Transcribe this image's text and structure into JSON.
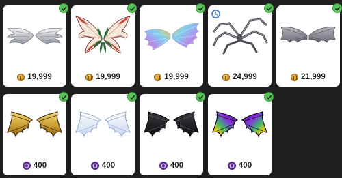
{
  "colors": {
    "background": "#1f1f1f",
    "card": "#ffffff",
    "owned_check": "#5bc15a",
    "coin": "#d39a2a",
    "gem": "#5b2f91",
    "timer": "#3a7bd5"
  },
  "items": [
    {
      "name": "angel-wings-silver",
      "price": "19,999",
      "currency": "coin-icon",
      "owned": true,
      "limited": false
    },
    {
      "name": "fairy-wings-red-green",
      "price": "19,999",
      "currency": "coin-icon",
      "owned": true,
      "limited": false
    },
    {
      "name": "rainbow-feather-wings",
      "price": "19,999",
      "currency": "coin-icon",
      "owned": true,
      "limited": false
    },
    {
      "name": "spider-leg-wings",
      "price": "24,999",
      "currency": "coin-icon",
      "owned": true,
      "limited": true
    },
    {
      "name": "gray-bat-wings",
      "price": "21,999",
      "currency": "coin-icon",
      "owned": true,
      "limited": false
    },
    {
      "name": "gold-dragon-wings",
      "price": "400",
      "currency": "gem-icon",
      "owned": true,
      "limited": false
    },
    {
      "name": "white-dragon-wings",
      "price": "400",
      "currency": "gem-icon",
      "owned": true,
      "limited": false
    },
    {
      "name": "black-dragon-wings",
      "price": "400",
      "currency": "gem-icon",
      "owned": true,
      "limited": false
    },
    {
      "name": "rainbow-dragon-wings",
      "price": "400",
      "currency": "gem-icon",
      "owned": true,
      "limited": false
    }
  ]
}
